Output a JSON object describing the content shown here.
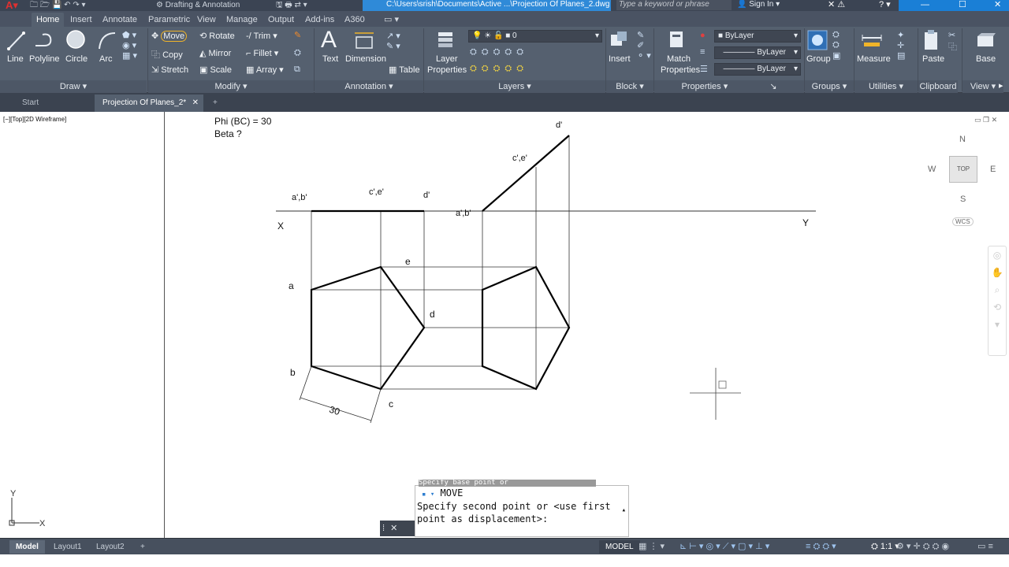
{
  "titlebar": {
    "workspace": "Drafting & Annotation",
    "document_path": "C:\\Users\\srish\\Documents\\Active ...\\Projection Of Planes_2.dwg",
    "search_placeholder": "Type a keyword or phrase",
    "sign_in": "Sign In"
  },
  "ribbon_tabs": [
    "Home",
    "Insert",
    "Annotate",
    "Parametric",
    "View",
    "Manage",
    "Output",
    "Add-ins",
    "A360"
  ],
  "ribbon": {
    "draw": {
      "title": "Draw",
      "line": "Line",
      "polyline": "Polyline",
      "circle": "Circle",
      "arc": "Arc"
    },
    "modify": {
      "title": "Modify",
      "move": "Move",
      "rotate": "Rotate",
      "trim": "Trim",
      "copy": "Copy",
      "mirror": "Mirror",
      "fillet": "Fillet",
      "stretch": "Stretch",
      "scale": "Scale",
      "array": "Array"
    },
    "annotation": {
      "title": "Annotation",
      "text": "Text",
      "dimension": "Dimension",
      "table": "Table"
    },
    "layers": {
      "title": "Layers",
      "layer_properties_1": "Layer",
      "layer_properties_2": "Properties",
      "current_layer": "0"
    },
    "block": {
      "title": "Block",
      "insert": "Insert"
    },
    "properties": {
      "title": "Properties",
      "match_1": "Match",
      "match_2": "Properties",
      "color": "ByLayer",
      "linetype": "ByLayer",
      "lineweight": "ByLayer"
    },
    "groups": {
      "title": "Groups",
      "group": "Group"
    },
    "utilities": {
      "title": "Utilities",
      "measure": "Measure"
    },
    "clipboard": {
      "title": "Clipboard",
      "paste": "Paste"
    },
    "view": {
      "title": "View",
      "base": "Base"
    }
  },
  "doc_tabs": {
    "start": "Start",
    "active": "Projection Of Planes_2*"
  },
  "viewport_label": "[−][Top][2D Wireframe]",
  "drawing": {
    "given_1": "Phi (BC) = 30",
    "given_2": "Beta ?",
    "labels": {
      "ab_front": "a',b'",
      "ce_front": "c',e'",
      "d_front": "d'",
      "ab_front2": "a',b'",
      "ce_front2": "c',e'",
      "d_front2": "d'",
      "x": "X",
      "y": "Y",
      "a": "a",
      "b": "b",
      "c": "c",
      "d": "d",
      "e": "e",
      "dim30": "30"
    }
  },
  "viewcube": {
    "n": "N",
    "s": "S",
    "e": "E",
    "w": "W",
    "top": "TOP",
    "wcs": "WCS"
  },
  "command": {
    "hint": "Specify base point or",
    "name": "MOVE",
    "prompt": "Specify second point or <use first point as displacement>:"
  },
  "status": {
    "model_tab": "Model",
    "layout1": "Layout1",
    "layout2": "Layout2",
    "model_label": "MODEL",
    "scale": "1:1"
  },
  "colors": {
    "ribbon": "#55606f",
    "titlebar": "#3b4453",
    "accent": "#1a7fd6"
  }
}
